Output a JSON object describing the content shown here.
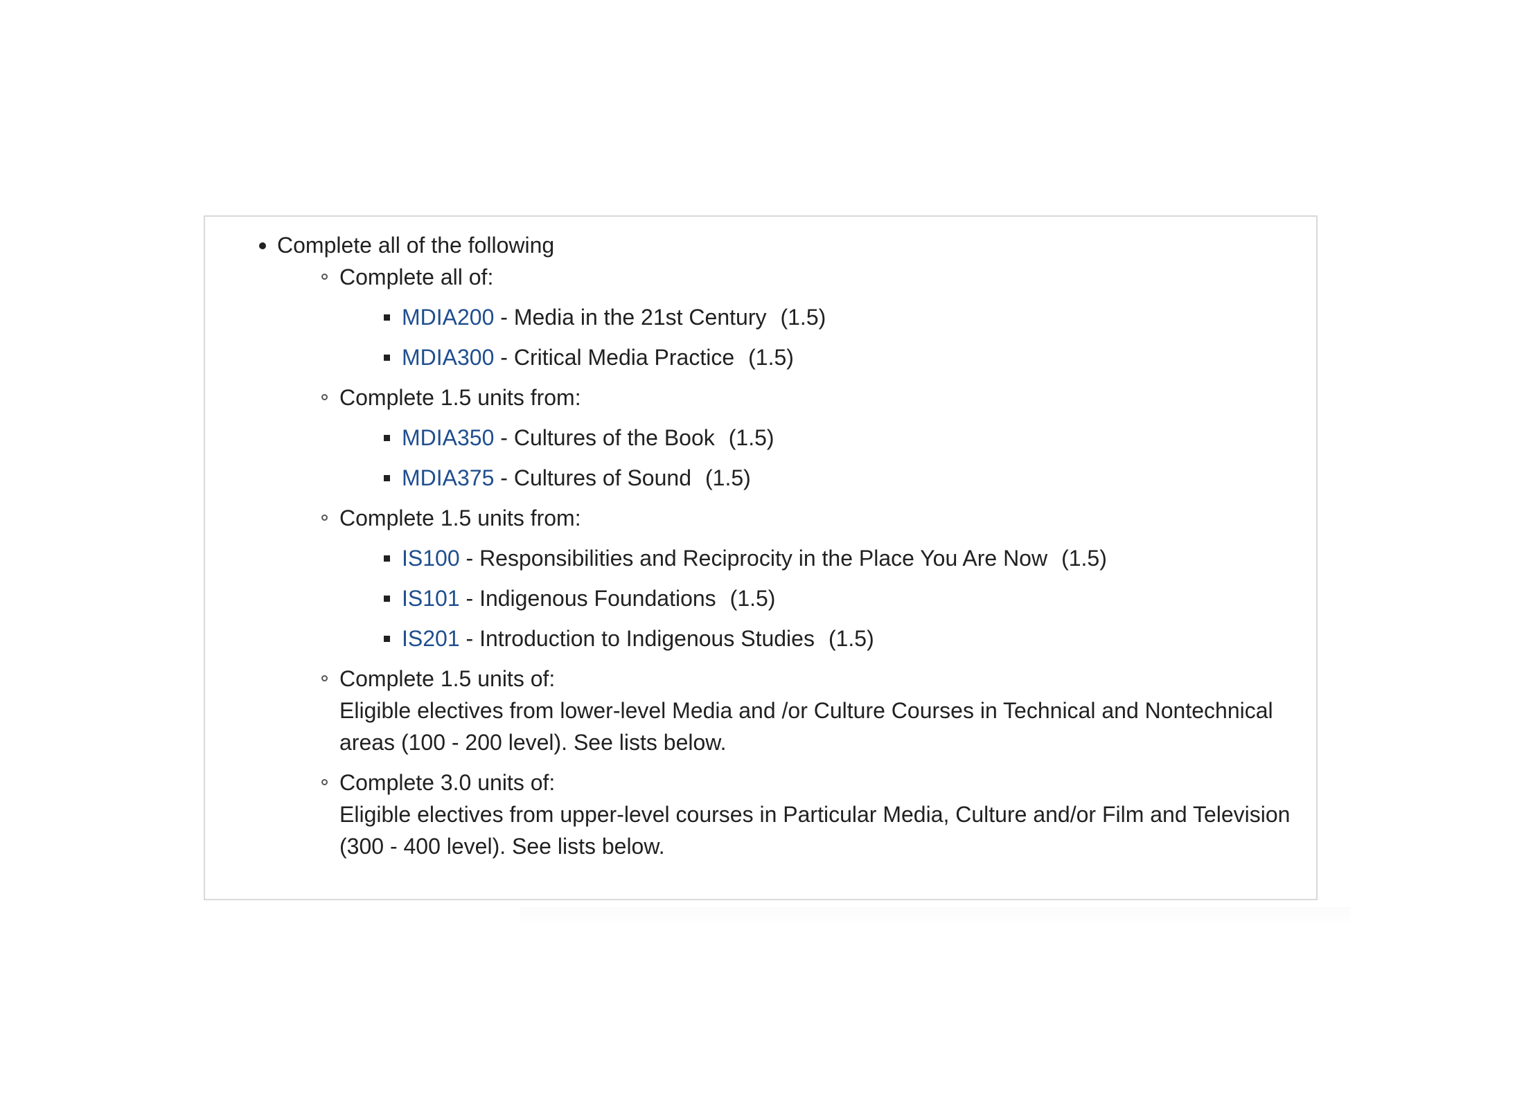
{
  "requirements": {
    "heading": "Complete all of the following",
    "groups": [
      {
        "label": "Complete all of:",
        "courses": [
          {
            "code": "MDIA200",
            "title": " - Media in the 21st Century",
            "units": "(1.5)"
          },
          {
            "code": "MDIA300",
            "title": " - Critical Media Practice",
            "units": "(1.5)"
          }
        ]
      },
      {
        "label": "Complete 1.5 units from:",
        "courses": [
          {
            "code": "MDIA350",
            "title": " - Cultures of the Book",
            "units": "(1.5)"
          },
          {
            "code": "MDIA375",
            "title": " - Cultures of Sound",
            "units": "(1.5)"
          }
        ]
      },
      {
        "label": "Complete 1.5 units from:",
        "courses": [
          {
            "code": "IS100",
            "title": " - Responsibilities and Reciprocity in the Place You Are Now",
            "units": "(1.5)"
          },
          {
            "code": "IS101",
            "title": " - Indigenous Foundations",
            "units": "(1.5)"
          },
          {
            "code": "IS201",
            "title": " - Introduction to Indigenous Studies",
            "units": "(1.5)"
          }
        ]
      },
      {
        "label": "Complete 1.5 units of:",
        "description": "Eligible electives from lower-level Media and /or Culture Courses in Technical and Nontechnical areas (100 - 200 level). See lists below."
      },
      {
        "label": "Complete 3.0 units of:",
        "description": "Eligible electives from upper-level courses in Particular Media, Culture and/or Film and Television (300 - 400 level). See lists below."
      }
    ]
  },
  "colors": {
    "link": "#1f4e8f",
    "text": "#212121",
    "border": "#d9d9d9"
  }
}
